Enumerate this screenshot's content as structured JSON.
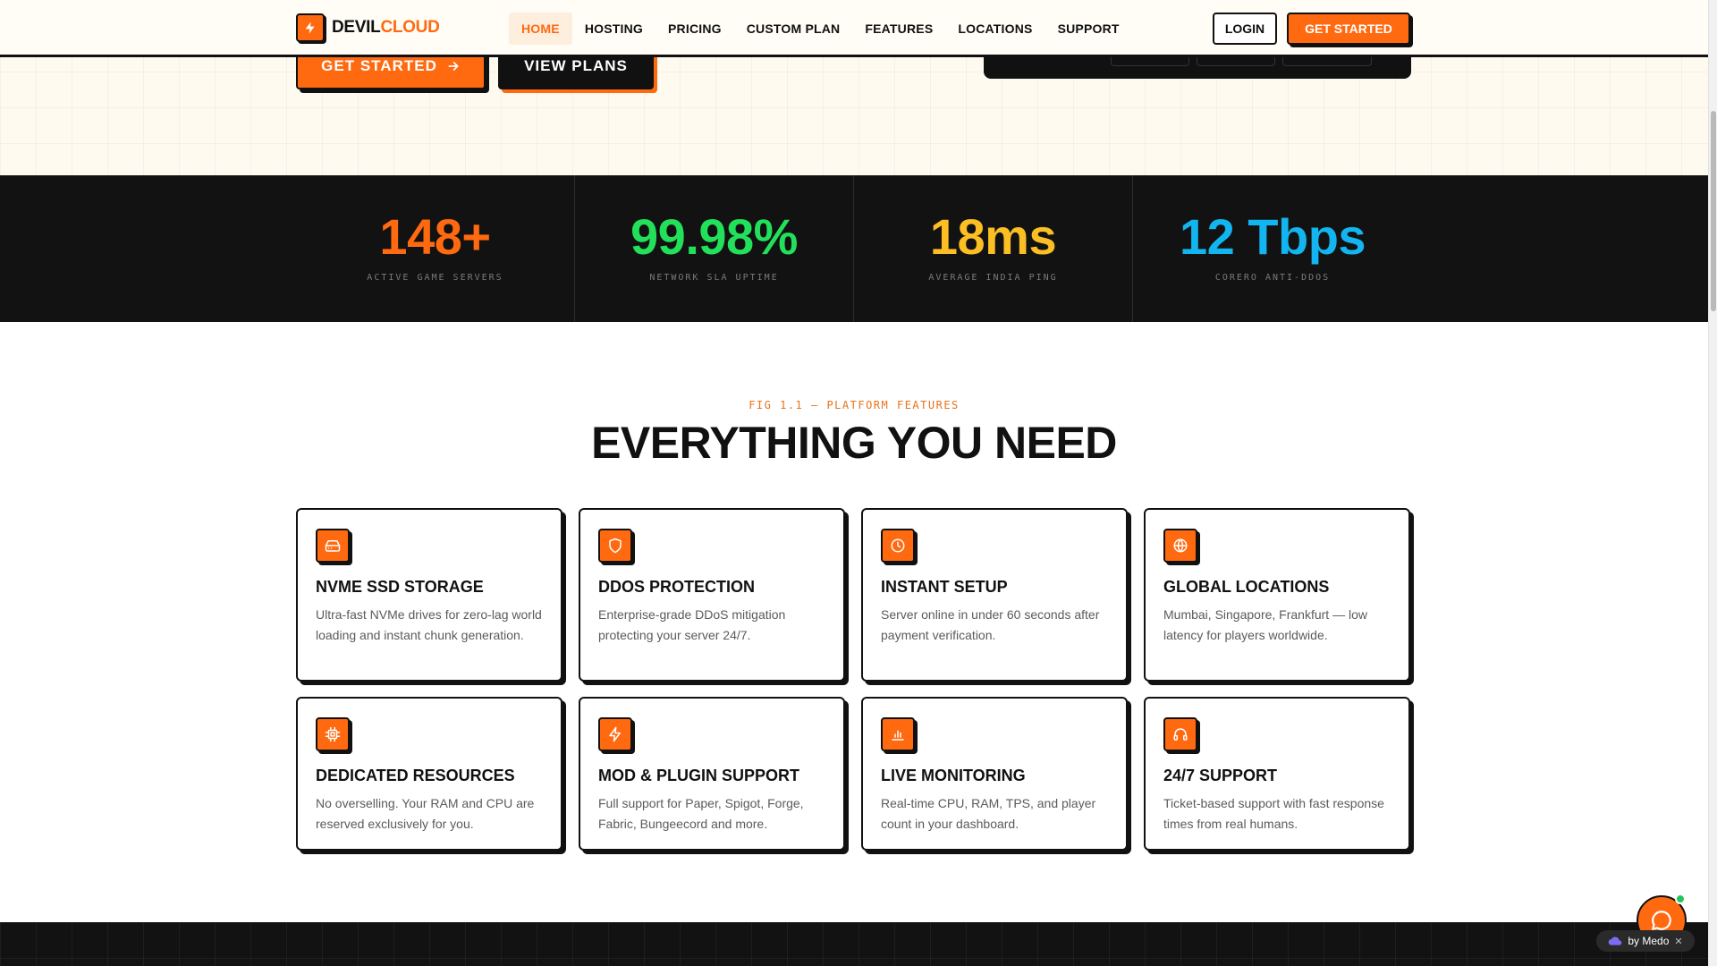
{
  "brand": {
    "name_part1": "DEVIL",
    "name_part2": "CLOUD",
    "accent": "#ff6a10"
  },
  "nav": {
    "links": [
      {
        "label": "HOME",
        "active": true
      },
      {
        "label": "HOSTING"
      },
      {
        "label": "PRICING"
      },
      {
        "label": "CUSTOM PLAN"
      },
      {
        "label": "FEATURES"
      },
      {
        "label": "LOCATIONS"
      },
      {
        "label": "SUPPORT"
      }
    ],
    "login_label": "LOGIN",
    "cta_label": "GET STARTED"
  },
  "hero": {
    "primary_label": "GET STARTED",
    "primary_icon": "arrow-right-icon",
    "secondary_label": "VIEW PLANS"
  },
  "stats": [
    {
      "value": "148+",
      "label": "ACTIVE GAME SERVERS",
      "color": "#ff6a10"
    },
    {
      "value": "99.98%",
      "label": "NETWORK SLA UPTIME",
      "color": "#22e05a"
    },
    {
      "value": "18ms",
      "label": "AVERAGE INDIA PING",
      "color": "#fbbf24"
    },
    {
      "value": "12 Tbps",
      "label": "CORERO ANTI-DDOS",
      "color": "#12b5ef"
    }
  ],
  "features": {
    "eyebrow": "FIG 1.1 — PLATFORM FEATURES",
    "title": "EVERYTHING YOU NEED",
    "items": [
      {
        "icon": "hard-drive-icon",
        "title": "NVME SSD STORAGE",
        "desc": "Ultra-fast NVMe drives for zero-lag world loading and instant chunk generation."
      },
      {
        "icon": "shield-icon",
        "title": "DDOS PROTECTION",
        "desc": "Enterprise-grade DDoS mitigation protecting your server 24/7."
      },
      {
        "icon": "clock-icon",
        "title": "INSTANT SETUP",
        "desc": "Server online in under 60 seconds after payment verification."
      },
      {
        "icon": "globe-icon",
        "title": "GLOBAL LOCATIONS",
        "desc": "Mumbai, Singapore, Frankfurt — low latency for players worldwide."
      },
      {
        "icon": "cpu-icon",
        "title": "DEDICATED RESOURCES",
        "desc": "No overselling. Your RAM and CPU are reserved exclusively for you."
      },
      {
        "icon": "bolt-icon",
        "title": "MOD & PLUGIN SUPPORT",
        "desc": "Full support for Paper, Spigot, Forge, Fabric, Bungeecord and more."
      },
      {
        "icon": "bar-chart-icon",
        "title": "LIVE MONITORING",
        "desc": "Real-time CPU, RAM, TPS, and player count in your dashboard."
      },
      {
        "icon": "headphones-icon",
        "title": "24/7 SUPPORT",
        "desc": "Ticket-based support with fast response times from real humans."
      }
    ]
  },
  "widget": {
    "badge_label": "by Medo",
    "chat_icon": "chat-bubble-icon"
  }
}
